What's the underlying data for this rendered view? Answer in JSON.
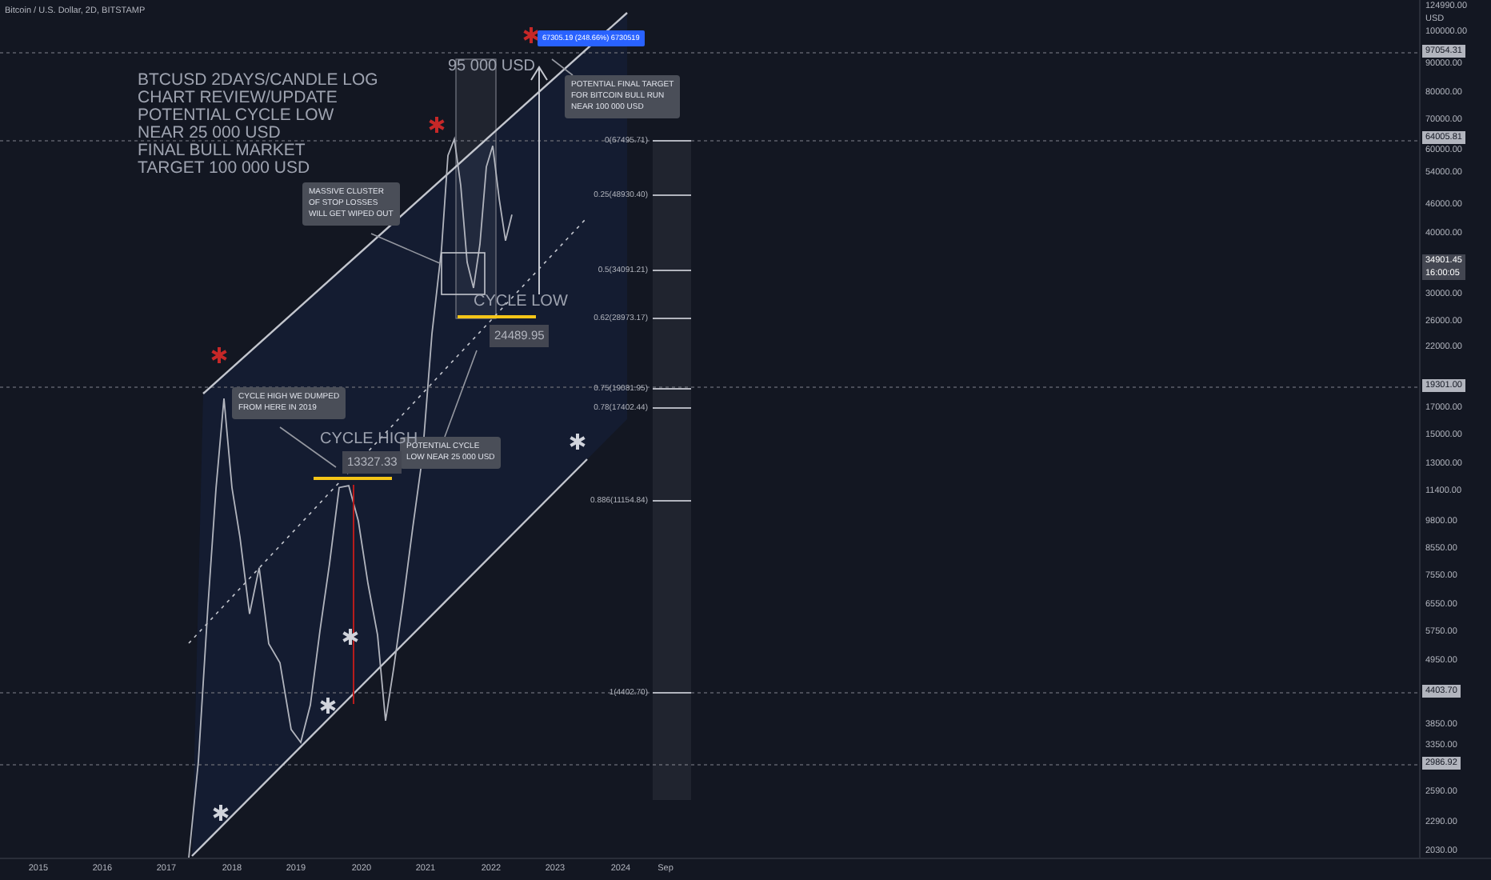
{
  "header": {
    "symbol": "Bitcoin / U.S. Dollar, 2D, BITSTAMP"
  },
  "title_note": {
    "lines": [
      "BTCUSD 2DAYS/CANDLE LOG",
      "CHART REVIEW/UPDATE",
      "POTENTIAL CYCLE LOW",
      "NEAR 25 000 USD",
      "FINAL BULL MARKET",
      "TARGET 100 000 USD"
    ]
  },
  "target_label": "95 000 USD",
  "measure_tag": "67305.19 (248.66%) 6730519",
  "callouts": [
    {
      "lines": [
        "MASSIVE CLUSTER",
        "OF STOP LOSSES",
        "WILL GET WIPED OUT"
      ]
    },
    {
      "lines": [
        "POTENTIAL FINAL TARGET",
        "FOR BITCOIN BULL RUN",
        "NEAR 100 000 USD"
      ]
    },
    {
      "lines": [
        "CYCLE HIGH WE DUMPED",
        "FROM HERE IN 2019"
      ]
    },
    {
      "lines": [
        "POTENTIAL CYCLE",
        "LOW NEAR 25 000 USD"
      ]
    }
  ],
  "cycle_labels": [
    {
      "title": "CYCLE LOW",
      "price": "24489.95"
    },
    {
      "title": "CYCLE HIGH",
      "price": "13327.33"
    }
  ],
  "fib_levels": [
    "0(67495.71)",
    "0.25(48930.40)",
    "0.5(34091.21)",
    "0.62(28973.17)",
    "0.75(19081.95)",
    "0.78(17402.44)",
    "0.886(11154.84)",
    "1(4402.70)"
  ],
  "markers": [
    {
      "color": "#c62828"
    },
    {
      "color": "#c62828"
    },
    {
      "color": "#c62828"
    },
    {
      "color": "#d1d4dc"
    },
    {
      "color": "#d1d4dc"
    },
    {
      "color": "#d1d4dc"
    },
    {
      "color": "#d1d4dc"
    }
  ],
  "price_axis": {
    "top_value": "124990.00",
    "currency": "USD",
    "ticks": [
      "100000.00",
      "90000.00",
      "80000.00",
      "70000.00",
      "60000.00",
      "54000.00",
      "46000.00",
      "40000.00",
      "30000.00",
      "26000.00",
      "22000.00",
      "17000.00",
      "15000.00",
      "13000.00",
      "11400.00",
      "9800.00",
      "8550.00",
      "7550.00",
      "6550.00",
      "5750.00",
      "4950.00",
      "3850.00",
      "3350.00",
      "2590.00",
      "2290.00",
      "2030.00"
    ],
    "tags": [
      {
        "kind": "level",
        "price": "97054.31"
      },
      {
        "kind": "level",
        "price": "64005.81"
      },
      {
        "kind": "current",
        "price": "34901.45",
        "countdown": "16:00:05"
      },
      {
        "kind": "level",
        "price": "19301.00"
      },
      {
        "kind": "level",
        "price": "4403.70"
      },
      {
        "kind": "level",
        "price": "2986.92"
      }
    ]
  },
  "time_axis": {
    "labels": [
      "2015",
      "2016",
      "2017",
      "2018",
      "2019",
      "2020",
      "2021",
      "2022",
      "2023",
      "2024",
      "Sep"
    ]
  }
}
